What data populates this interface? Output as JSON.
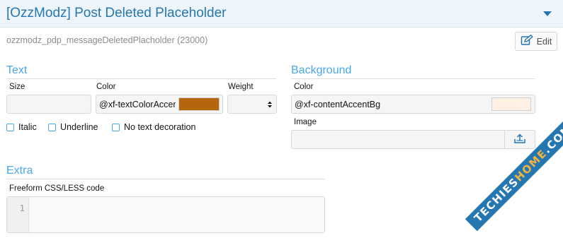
{
  "header": {
    "title": "[OzzModz] Post Deleted Placeholder",
    "collapse_icon": "caret-down-icon"
  },
  "template": {
    "name": "ozzmodz_pdp_messageDeletedPlacholder",
    "id": "(23000)",
    "edit_label": "Edit",
    "edit_icon": "edit-icon"
  },
  "text_section": {
    "title": "Text",
    "size_label": "Size",
    "size_value": "",
    "color_label": "Color",
    "color_value": "@xf-textColorAccent",
    "color_swatch": "#b5650b",
    "weight_label": "Weight",
    "weight_value": "",
    "checkboxes": [
      {
        "label": "Italic",
        "checked": false
      },
      {
        "label": "Underline",
        "checked": false
      },
      {
        "label": "No text decoration",
        "checked": false
      }
    ]
  },
  "background_section": {
    "title": "Background",
    "color_label": "Color",
    "color_value": "@xf-contentAccentBg",
    "color_swatch": "#fef1e3",
    "image_label": "Image",
    "image_value": "",
    "upload_icon": "upload-icon"
  },
  "extra_section": {
    "title": "Extra",
    "code_label": "Freeform CSS/LESS code",
    "line_number": "1",
    "code_value": ""
  },
  "watermark": {
    "text_primary": "TECHIES",
    "text_accent": "HOME",
    "suffix": ".COM"
  },
  "colors": {
    "header_bg": "#edf4fa",
    "accent_blue": "#2577b1",
    "section_blue": "#47a7eb"
  }
}
